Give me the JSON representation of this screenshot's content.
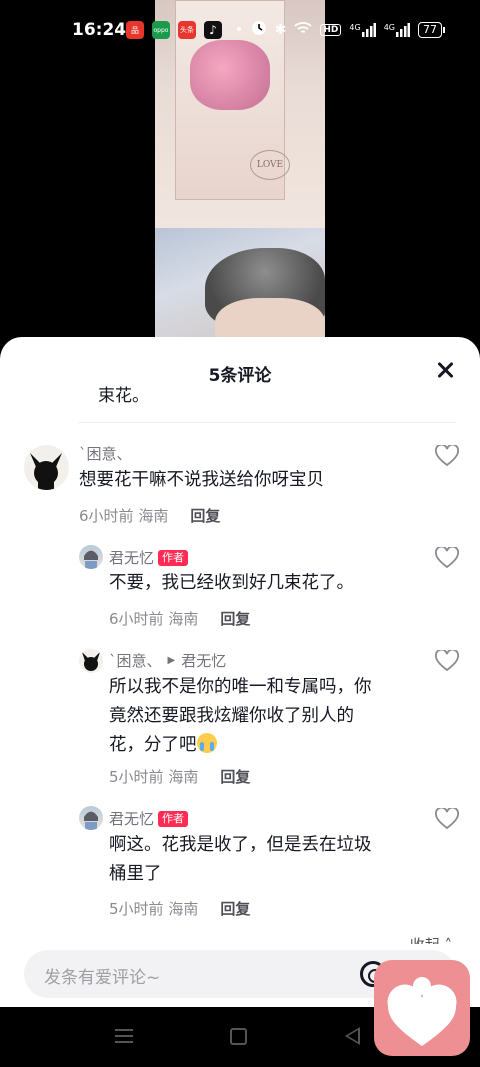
{
  "status_bar": {
    "time": "16:24",
    "apps": [
      {
        "name": "app-icon-1",
        "color": "#e8362d",
        "label": "品"
      },
      {
        "name": "app-icon-2",
        "color": "#1a9b4b",
        "label": "oppo"
      },
      {
        "name": "app-icon-3",
        "color": "#e8362d",
        "label": "头条"
      },
      {
        "name": "tiktok-icon",
        "color": "#111111",
        "label": "♪"
      }
    ],
    "network_1": "4G",
    "network_2": "4G",
    "hd_label": "HD",
    "battery": "77"
  },
  "video": {
    "tag_text": "LOVE"
  },
  "sheet": {
    "title": "5条评论",
    "previous_snippet": "束花。"
  },
  "comments": [
    {
      "user": "`困意、",
      "text": "想要花干嘛不说我送给你呀宝贝",
      "time": "6小时前",
      "location": "海南",
      "reply_label": "回复"
    },
    {
      "user": "君无忆",
      "author_tag": "作者",
      "text": "不要，我已经收到好几束花了。",
      "time": "6小时前",
      "location": "海南",
      "reply_label": "回复"
    },
    {
      "user": "`困意、",
      "reply_to": "君无忆",
      "text_line1": "所以我不是你的唯一和专属吗，你",
      "text_line2": "竟然还要跟我炫耀你收了别人的",
      "text_line3": "花，分了吧",
      "time": "5小时前",
      "location": "海南",
      "reply_label": "回复"
    },
    {
      "user": "君无忆",
      "author_tag": "作者",
      "text_line1": "啊这。花我是收了，但是丢在垃圾",
      "text_line2": "桶里了",
      "time": "5小时前",
      "location": "海南",
      "reply_label": "回复"
    }
  ],
  "collapse_label": "收起",
  "input": {
    "placeholder": "发条有爱评论~"
  },
  "colors": {
    "accent": "#fe2c55",
    "widget": "#ee8f93"
  }
}
